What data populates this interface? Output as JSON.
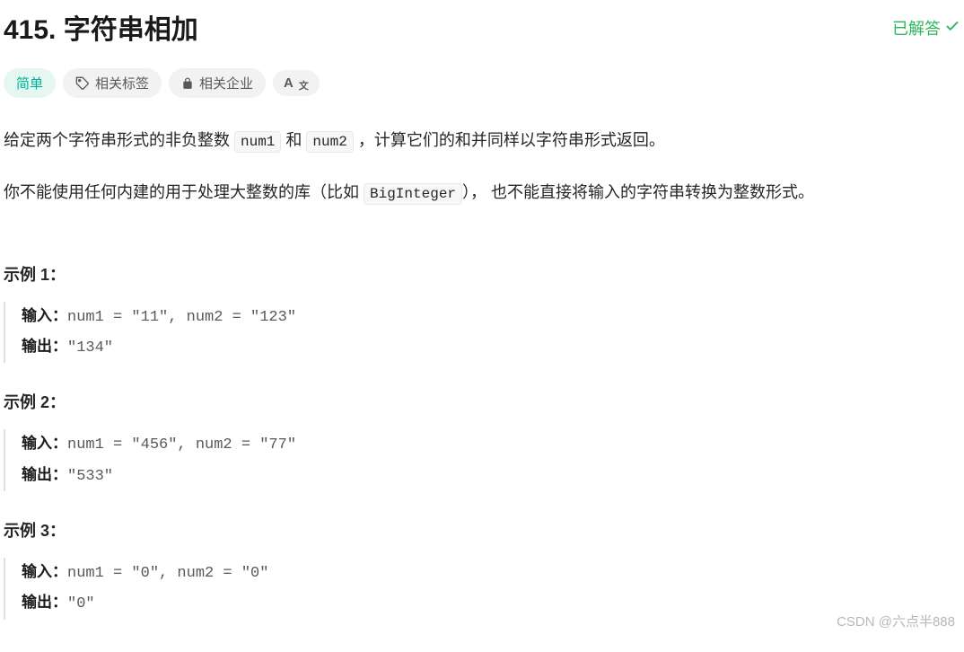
{
  "header": {
    "title": "415. 字符串相加",
    "solved": "已解答"
  },
  "tags": {
    "difficulty": "简单",
    "related_tags": "相关标签",
    "related_companies": "相关企业",
    "font_size": "A"
  },
  "description": {
    "p1_prefix": "给定两个字符串形式的非负整数 ",
    "code1": "num1",
    "p1_mid": " 和 ",
    "code2": "num2",
    "p1_suffix": " ，计算它们的和并同样以字符串形式返回。",
    "p2_prefix": "你不能使用任何内建的用于处理大整数的库（比如 ",
    "code3": "BigInteger",
    "p2_suffix": "），  也不能直接将输入的字符串转换为整数形式。"
  },
  "examples": [
    {
      "title": "示例 1：",
      "input_label": "输入：",
      "input_value": "num1 = \"11\", num2 = \"123\"",
      "output_label": "输出：",
      "output_value": "\"134\""
    },
    {
      "title": "示例 2：",
      "input_label": "输入：",
      "input_value": "num1 = \"456\", num2 = \"77\"",
      "output_label": "输出：",
      "output_value": "\"533\""
    },
    {
      "title": "示例 3：",
      "input_label": "输入：",
      "input_value": "num1 = \"0\", num2 = \"0\"",
      "output_label": "输出：",
      "output_value": "\"0\""
    }
  ],
  "watermark": "CSDN @六点半888"
}
